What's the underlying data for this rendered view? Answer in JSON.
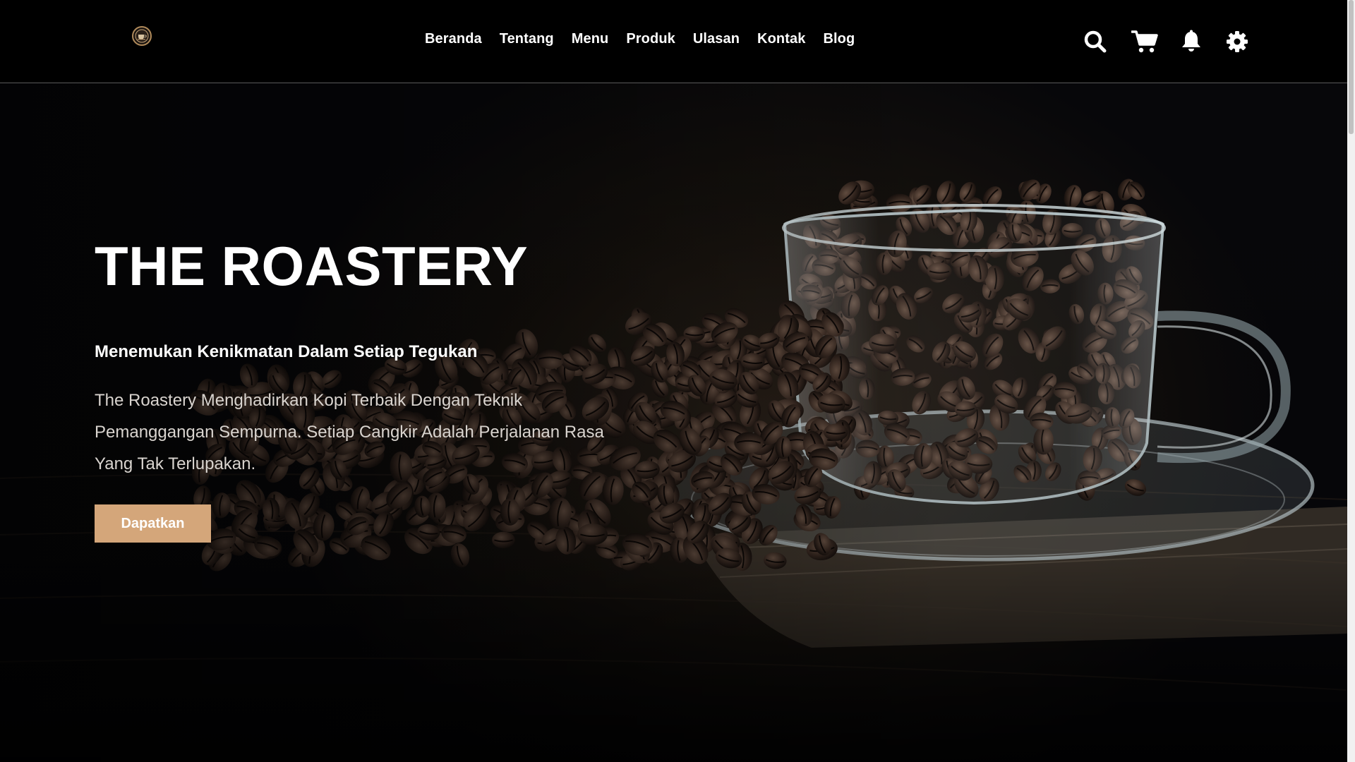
{
  "brand": {
    "logo_icon": "coffee-cup-logo"
  },
  "nav": {
    "links": [
      "Beranda",
      "Tentang",
      "Menu",
      "Produk",
      "Ulasan",
      "Kontak",
      "Blog"
    ],
    "icons": [
      "search-icon",
      "cart-icon",
      "bell-icon",
      "gear-icon"
    ]
  },
  "hero": {
    "title": "THE ROASTERY",
    "subtitle": "Menemukan Kenikmatan Dalam Setiap Tegukan",
    "description": "The Roastery Menghadirkan Kopi Terbaik Dengan Teknik Pemanggangan Sempurna. Setiap Cangkir Adalah Perjalanan Rasa Yang Tak Terlupakan.",
    "cta_label": "Dapatkan"
  },
  "colors": {
    "accent": "#d4a67a",
    "navbar_bg": "#000000",
    "text": "#ffffff"
  }
}
